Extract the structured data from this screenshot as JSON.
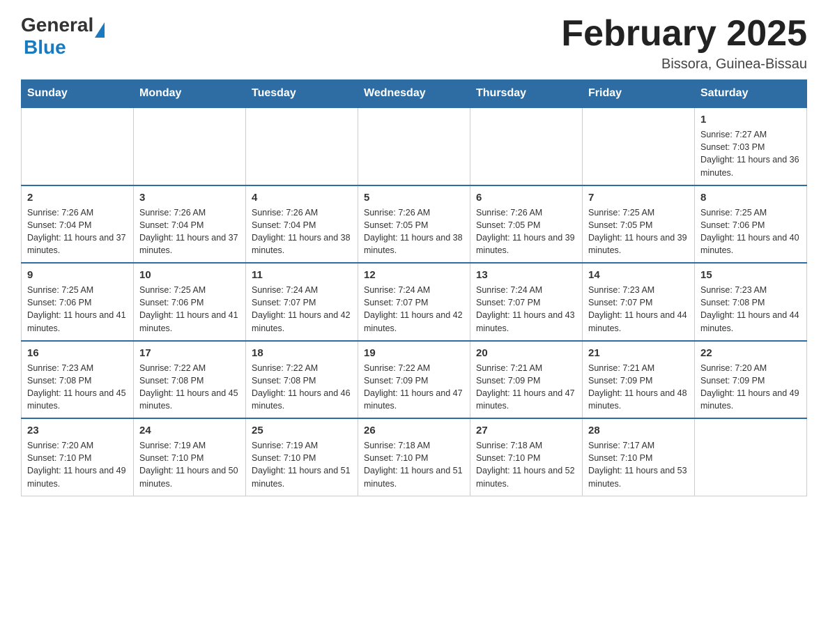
{
  "header": {
    "title": "February 2025",
    "subtitle": "Bissora, Guinea-Bissau",
    "logo_general": "General",
    "logo_blue": "Blue"
  },
  "days_of_week": [
    "Sunday",
    "Monday",
    "Tuesday",
    "Wednesday",
    "Thursday",
    "Friday",
    "Saturday"
  ],
  "weeks": [
    [
      {
        "day": "",
        "info": ""
      },
      {
        "day": "",
        "info": ""
      },
      {
        "day": "",
        "info": ""
      },
      {
        "day": "",
        "info": ""
      },
      {
        "day": "",
        "info": ""
      },
      {
        "day": "",
        "info": ""
      },
      {
        "day": "1",
        "info": "Sunrise: 7:27 AM\nSunset: 7:03 PM\nDaylight: 11 hours and 36 minutes."
      }
    ],
    [
      {
        "day": "2",
        "info": "Sunrise: 7:26 AM\nSunset: 7:04 PM\nDaylight: 11 hours and 37 minutes."
      },
      {
        "day": "3",
        "info": "Sunrise: 7:26 AM\nSunset: 7:04 PM\nDaylight: 11 hours and 37 minutes."
      },
      {
        "day": "4",
        "info": "Sunrise: 7:26 AM\nSunset: 7:04 PM\nDaylight: 11 hours and 38 minutes."
      },
      {
        "day": "5",
        "info": "Sunrise: 7:26 AM\nSunset: 7:05 PM\nDaylight: 11 hours and 38 minutes."
      },
      {
        "day": "6",
        "info": "Sunrise: 7:26 AM\nSunset: 7:05 PM\nDaylight: 11 hours and 39 minutes."
      },
      {
        "day": "7",
        "info": "Sunrise: 7:25 AM\nSunset: 7:05 PM\nDaylight: 11 hours and 39 minutes."
      },
      {
        "day": "8",
        "info": "Sunrise: 7:25 AM\nSunset: 7:06 PM\nDaylight: 11 hours and 40 minutes."
      }
    ],
    [
      {
        "day": "9",
        "info": "Sunrise: 7:25 AM\nSunset: 7:06 PM\nDaylight: 11 hours and 41 minutes."
      },
      {
        "day": "10",
        "info": "Sunrise: 7:25 AM\nSunset: 7:06 PM\nDaylight: 11 hours and 41 minutes."
      },
      {
        "day": "11",
        "info": "Sunrise: 7:24 AM\nSunset: 7:07 PM\nDaylight: 11 hours and 42 minutes."
      },
      {
        "day": "12",
        "info": "Sunrise: 7:24 AM\nSunset: 7:07 PM\nDaylight: 11 hours and 42 minutes."
      },
      {
        "day": "13",
        "info": "Sunrise: 7:24 AM\nSunset: 7:07 PM\nDaylight: 11 hours and 43 minutes."
      },
      {
        "day": "14",
        "info": "Sunrise: 7:23 AM\nSunset: 7:07 PM\nDaylight: 11 hours and 44 minutes."
      },
      {
        "day": "15",
        "info": "Sunrise: 7:23 AM\nSunset: 7:08 PM\nDaylight: 11 hours and 44 minutes."
      }
    ],
    [
      {
        "day": "16",
        "info": "Sunrise: 7:23 AM\nSunset: 7:08 PM\nDaylight: 11 hours and 45 minutes."
      },
      {
        "day": "17",
        "info": "Sunrise: 7:22 AM\nSunset: 7:08 PM\nDaylight: 11 hours and 45 minutes."
      },
      {
        "day": "18",
        "info": "Sunrise: 7:22 AM\nSunset: 7:08 PM\nDaylight: 11 hours and 46 minutes."
      },
      {
        "day": "19",
        "info": "Sunrise: 7:22 AM\nSunset: 7:09 PM\nDaylight: 11 hours and 47 minutes."
      },
      {
        "day": "20",
        "info": "Sunrise: 7:21 AM\nSunset: 7:09 PM\nDaylight: 11 hours and 47 minutes."
      },
      {
        "day": "21",
        "info": "Sunrise: 7:21 AM\nSunset: 7:09 PM\nDaylight: 11 hours and 48 minutes."
      },
      {
        "day": "22",
        "info": "Sunrise: 7:20 AM\nSunset: 7:09 PM\nDaylight: 11 hours and 49 minutes."
      }
    ],
    [
      {
        "day": "23",
        "info": "Sunrise: 7:20 AM\nSunset: 7:10 PM\nDaylight: 11 hours and 49 minutes."
      },
      {
        "day": "24",
        "info": "Sunrise: 7:19 AM\nSunset: 7:10 PM\nDaylight: 11 hours and 50 minutes."
      },
      {
        "day": "25",
        "info": "Sunrise: 7:19 AM\nSunset: 7:10 PM\nDaylight: 11 hours and 51 minutes."
      },
      {
        "day": "26",
        "info": "Sunrise: 7:18 AM\nSunset: 7:10 PM\nDaylight: 11 hours and 51 minutes."
      },
      {
        "day": "27",
        "info": "Sunrise: 7:18 AM\nSunset: 7:10 PM\nDaylight: 11 hours and 52 minutes."
      },
      {
        "day": "28",
        "info": "Sunrise: 7:17 AM\nSunset: 7:10 PM\nDaylight: 11 hours and 53 minutes."
      },
      {
        "day": "",
        "info": ""
      }
    ]
  ]
}
